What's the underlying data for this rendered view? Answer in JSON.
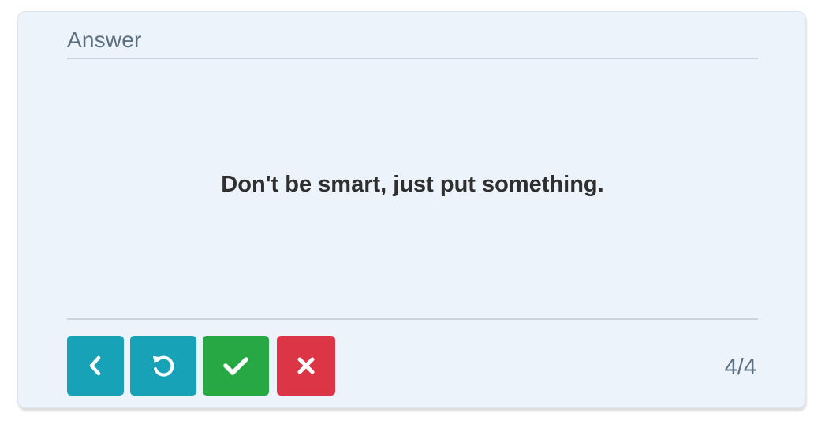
{
  "card": {
    "header": "Answer",
    "answer": "Don't be smart, just put something.",
    "counter": "4/4"
  },
  "controls": {
    "prev_icon": "chevron-left-icon",
    "reset_icon": "rotate-ccw-icon",
    "right_icon": "check-icon",
    "wrong_icon": "close-icon"
  },
  "colors": {
    "card_background": "#edf3fa",
    "info": "#17a2b8",
    "success": "#28a745",
    "danger": "#dc3545",
    "muted_text": "#5c7080"
  }
}
